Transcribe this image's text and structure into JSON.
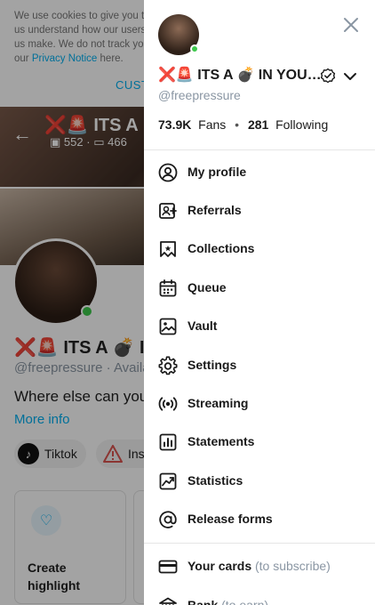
{
  "background": {
    "cookie_text": "We use cookies to give you the best experience on our website and to help us understand how our users. The only non-essential cookies we use help us make. We do not track you across other websites. Learn more here, and our",
    "cookie_link": "Privacy Notice",
    "cookie_tail": "here.",
    "cookie_customize": "CUSTOMIZE",
    "cover_title": "❌🚨 ITS A",
    "cover_photos": "552",
    "cover_videos": "466",
    "profile_name": "❌🚨 ITS A 💣 IN",
    "profile_handle": "@freepressure",
    "profile_status": "Available",
    "bio": "Where else can you find",
    "more_info": "More info",
    "chips": [
      {
        "label": "Tiktok",
        "icon": "tiktok-icon"
      },
      {
        "label": "Instagram",
        "icon": "warning-icon"
      }
    ],
    "cards": [
      {
        "label_line1": "Create",
        "label_line2": "highlight",
        "icon": "highlight-icon"
      }
    ]
  },
  "drawer": {
    "name": "❌🚨 ITS A 💣 IN YOU…",
    "handle": "@freepressure",
    "fans_count": "73.9K",
    "fans_label": "Fans",
    "following_count": "281",
    "following_label": "Following",
    "menu": [
      {
        "label": "My profile",
        "icon": "user-circle-icon"
      },
      {
        "label": "Referrals",
        "icon": "referrals-icon"
      },
      {
        "label": "Collections",
        "icon": "collections-icon"
      },
      {
        "label": "Queue",
        "icon": "calendar-icon"
      },
      {
        "label": "Vault",
        "icon": "image-icon"
      },
      {
        "label": "Settings",
        "icon": "gear-icon"
      },
      {
        "label": "Streaming",
        "icon": "broadcast-icon"
      },
      {
        "label": "Statements",
        "icon": "statements-icon"
      },
      {
        "label": "Statistics",
        "icon": "statistics-icon"
      },
      {
        "label": "Release forms",
        "icon": "at-sign-icon"
      }
    ],
    "payment_menu": [
      {
        "label": "Your cards",
        "note": "(to subscribe)",
        "icon": "card-icon"
      },
      {
        "label": "Bank",
        "note": "(to earn)",
        "icon": "bank-icon"
      }
    ]
  },
  "colors": {
    "accent": "#00aff0",
    "online": "#3ec84c",
    "muted": "#8a96a3",
    "overlay": "rgba(0,0,0,0.36)"
  }
}
